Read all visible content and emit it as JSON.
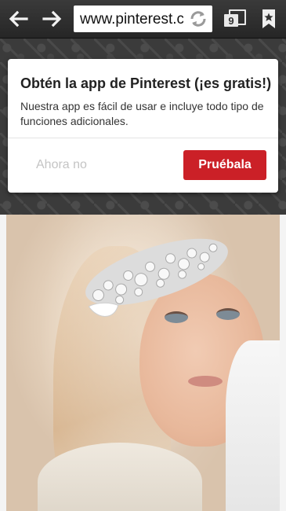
{
  "browser": {
    "url": "www.pinterest.com",
    "tab_count": "9"
  },
  "icons": {
    "back": "back-arrow-icon",
    "forward": "forward-arrow-icon",
    "reload": "reload-icon",
    "tabs": "tabs-icon",
    "bookmark": "bookmark-star-icon"
  },
  "dialog": {
    "title": "Obtén la app de Pinterest (¡es gratis!)",
    "body": "Nuestra app es fácil de usar e incluye todo tipo de funciones adicionales.",
    "later_label": "Ahora no",
    "try_label": "Pruébala"
  },
  "colors": {
    "accent": "#cb2027",
    "toolbar": "#2e2e2e"
  }
}
